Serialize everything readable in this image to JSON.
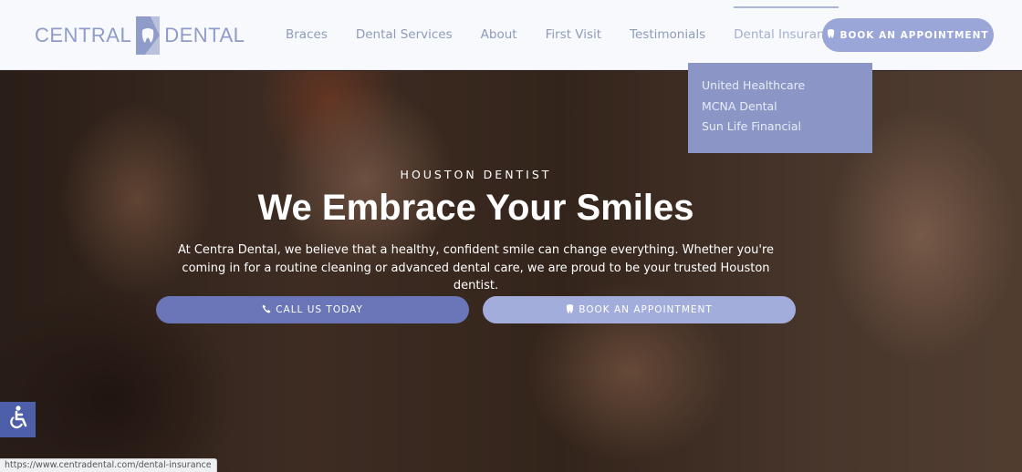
{
  "header": {
    "logo": {
      "left": "CENTRAL",
      "right": "DENTAL"
    },
    "nav": [
      {
        "label": "Braces"
      },
      {
        "label": "Dental Services"
      },
      {
        "label": "About"
      },
      {
        "label": "First Visit"
      },
      {
        "label": "Testimonials"
      },
      {
        "label": "Dental Insurance",
        "active": true
      }
    ],
    "cta": {
      "label": "BOOK AN APPOINTMENT",
      "icon": "tooth-icon"
    }
  },
  "dropdown": {
    "items": [
      "United Healthcare",
      "MCNA Dental",
      "Sun Life Financial"
    ]
  },
  "hero": {
    "eyebrow": "HOUSTON DENTIST",
    "headline": "We Embrace Your Smiles",
    "subtext": "At Centra Dental, we believe that a healthy, confident smile can change everything. Whether you're coming in for a routine cleaning or advanced dental care, we are proud to be your trusted Houston dentist.",
    "call_button": {
      "label": "CALL US TODAY",
      "icon": "phone-icon"
    },
    "book_button": {
      "label": "BOOK AN APPOINTMENT",
      "icon": "tooth-icon"
    }
  },
  "accessibility": {
    "icon": "wheelchair-icon"
  },
  "status_bar": {
    "url": "https://www.centradental.com/dental-insurance"
  },
  "colors": {
    "primary": "#6b76b9",
    "secondary": "#a3addc",
    "header_button": "#9aa6d8",
    "dropdown_bg": "#8c96c6",
    "nav_text": "#8f9bb9"
  }
}
